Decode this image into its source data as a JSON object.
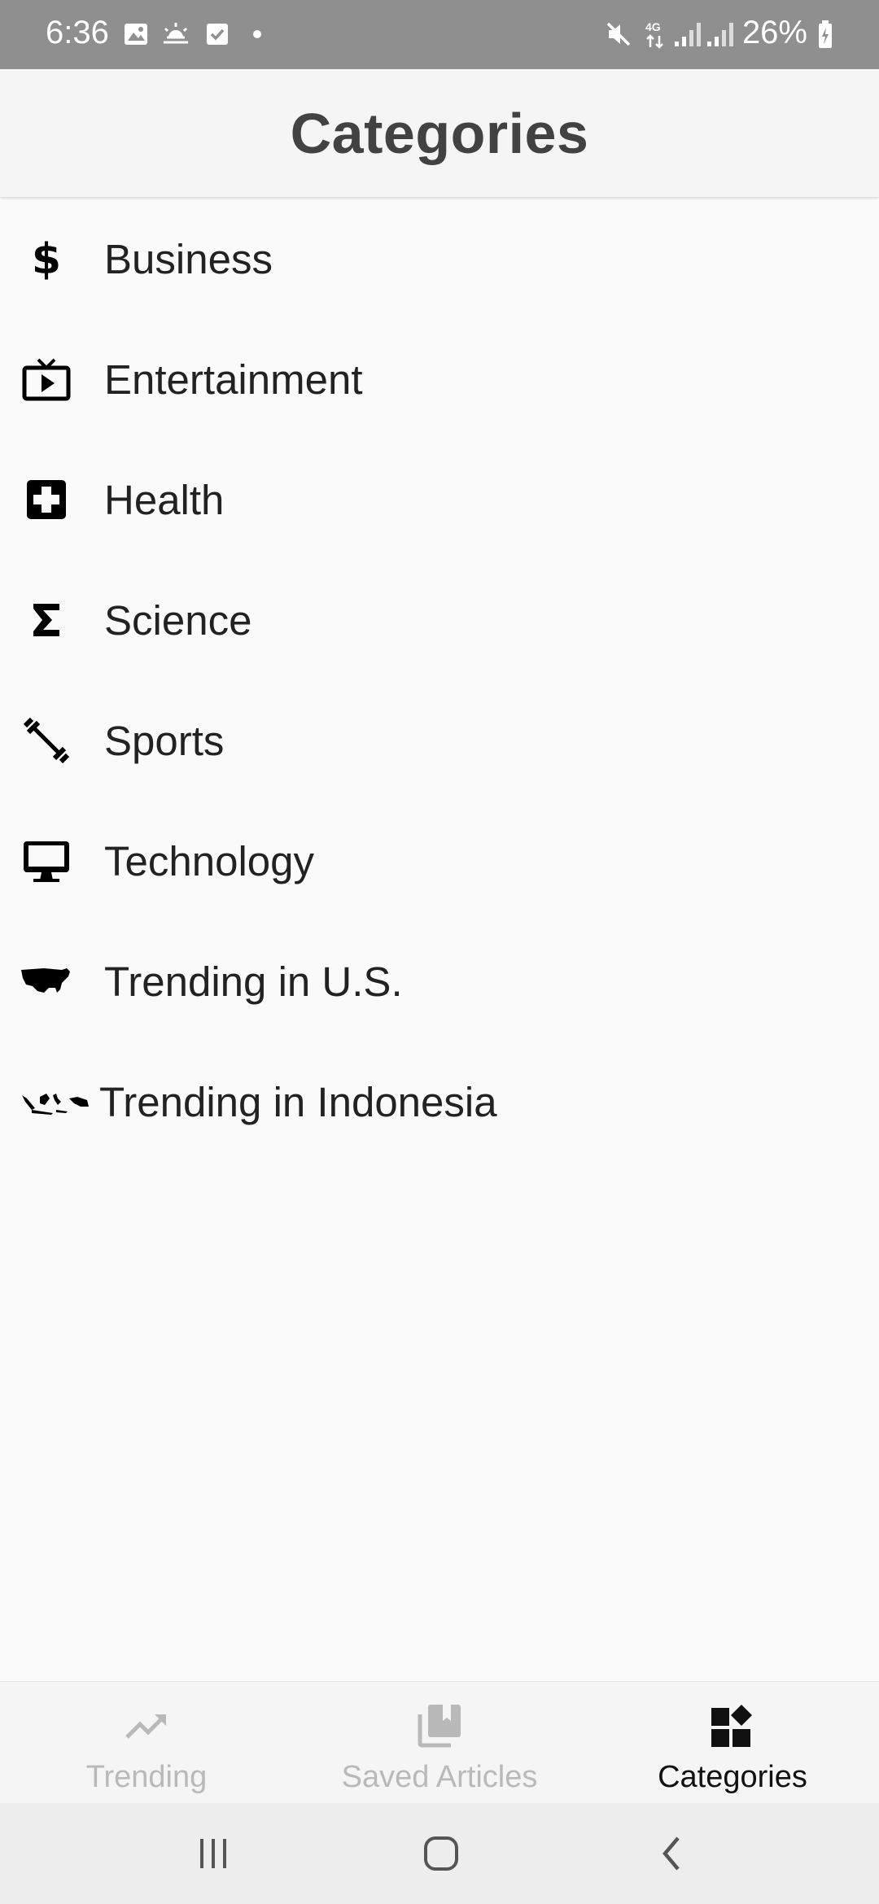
{
  "status_bar": {
    "time": "6:36",
    "battery": "26%",
    "icons": [
      "gallery-icon",
      "weather-icon",
      "checkbox-icon",
      "dot-icon",
      "mute-icon",
      "4g-icon",
      "signal-icon",
      "signal-icon",
      "battery-icon"
    ]
  },
  "header": {
    "title": "Categories"
  },
  "categories": [
    {
      "label": "Business",
      "icon": "dollar-icon"
    },
    {
      "label": "Entertainment",
      "icon": "tv-icon"
    },
    {
      "label": "Health",
      "icon": "medical-cross-icon"
    },
    {
      "label": "Science",
      "icon": "sigma-icon"
    },
    {
      "label": "Sports",
      "icon": "dumbbell-icon"
    },
    {
      "label": "Technology",
      "icon": "monitor-icon"
    },
    {
      "label": "Trending in U.S.",
      "icon": "usa-map-icon"
    },
    {
      "label": "Trending in Indonesia",
      "icon": "indonesia-map-icon"
    }
  ],
  "bottom_nav": {
    "tabs": [
      {
        "label": "Trending",
        "icon": "trending-icon",
        "active": false
      },
      {
        "label": "Saved Articles",
        "icon": "saved-articles-icon",
        "active": false
      },
      {
        "label": "Categories",
        "icon": "categories-icon",
        "active": true
      }
    ]
  },
  "system_nav": {
    "buttons": [
      "recent-apps-icon",
      "home-icon",
      "back-icon"
    ]
  },
  "colors": {
    "status_bar_bg": "#8f8f8f",
    "header_bg": "#f5f5f5",
    "page_bg": "#fafafa",
    "active_tab": "#111111",
    "inactive_tab": "#b9b9b9"
  }
}
